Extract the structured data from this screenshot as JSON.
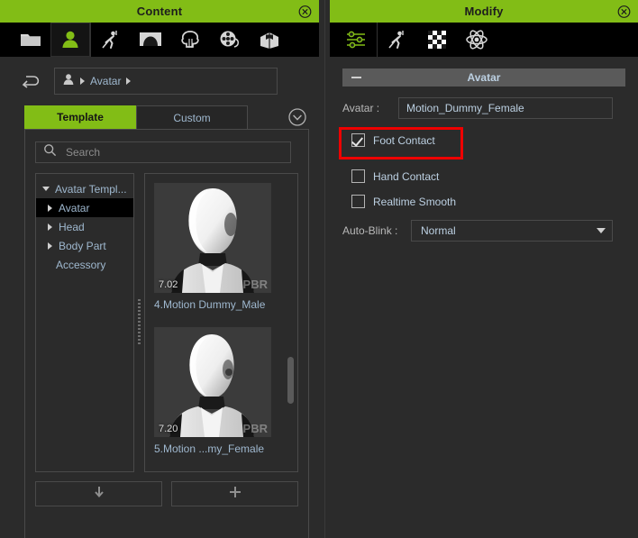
{
  "colors": {
    "accent_green": "#82bd16",
    "panel_bg": "#2b2b2b",
    "tabstrip_bg": "#000000",
    "label_blue": "#9fb8cf",
    "highlight_red": "#ee0000",
    "section_header": "#5a5a5a"
  },
  "content_panel": {
    "title": "Content",
    "close_icon": "close-circle-icon",
    "icon_tabs": [
      {
        "name": "folder-icon",
        "label": "Project",
        "selected": false
      },
      {
        "name": "avatar-person-icon",
        "label": "Avatar",
        "selected": true
      },
      {
        "name": "motion-pose-icon",
        "label": "Motion",
        "selected": false
      },
      {
        "name": "stage-scene-icon",
        "label": "Scene",
        "selected": false
      },
      {
        "name": "tree-prop-icon",
        "label": "Prop",
        "selected": false
      },
      {
        "name": "film-reel-icon",
        "label": "Media",
        "selected": false
      },
      {
        "name": "package-box-icon",
        "label": "Package",
        "selected": false
      }
    ],
    "back_button": "back-arrow-icon",
    "breadcrumb": {
      "icon": "avatar-person-icon",
      "items": [
        "Avatar"
      ]
    },
    "tabs": [
      {
        "label": "Template",
        "active": true
      },
      {
        "label": "Custom",
        "active": false
      }
    ],
    "expand_button": "chevron-down-circle-icon",
    "search": {
      "placeholder": "Search",
      "value": "",
      "icon": "search-icon"
    },
    "tree": [
      {
        "label": "Avatar Templ...",
        "expanded": true,
        "depth": 0,
        "selected": false,
        "has_children": true
      },
      {
        "label": "Avatar",
        "expanded": false,
        "depth": 1,
        "selected": true,
        "has_children": true
      },
      {
        "label": "Head",
        "expanded": false,
        "depth": 1,
        "selected": false,
        "has_children": true
      },
      {
        "label": "Body Part",
        "expanded": false,
        "depth": 1,
        "selected": false,
        "has_children": true
      },
      {
        "label": "Accessory",
        "expanded": false,
        "depth": 2,
        "selected": false,
        "has_children": false
      }
    ],
    "thumbnails": [
      {
        "label": "4.Motion Dummy_Male",
        "version": "7.02",
        "badge": "PBR"
      },
      {
        "label": "5.Motion ...my_Female",
        "version": "7.20",
        "badge": "PBR"
      }
    ],
    "footer_buttons": [
      {
        "name": "download-button",
        "icon": "down-arrow-icon"
      },
      {
        "name": "add-button",
        "icon": "plus-icon"
      }
    ]
  },
  "modify_panel": {
    "title": "Modify",
    "close_icon": "close-circle-icon",
    "icon_tabs": [
      {
        "name": "sliders-attribute-icon",
        "label": "Attribute",
        "selected": true
      },
      {
        "name": "motion-pose-icon",
        "label": "Motion",
        "selected": false
      },
      {
        "name": "checker-material-icon",
        "label": "Material",
        "selected": false
      },
      {
        "name": "atom-physics-icon",
        "label": "Physics",
        "selected": false
      }
    ],
    "section": {
      "title": "Avatar",
      "collapse_icon": "minus-icon",
      "expanded": true
    },
    "avatar_field": {
      "label": "Avatar :",
      "value": "Motion_Dummy_Female"
    },
    "checkboxes": [
      {
        "label": "Foot Contact",
        "checked": true,
        "highlighted": true
      },
      {
        "label": "Hand Contact",
        "checked": false,
        "highlighted": false
      },
      {
        "label": "Realtime Smooth",
        "checked": false,
        "highlighted": false
      }
    ],
    "auto_blink": {
      "label": "Auto-Blink :",
      "value": "Normal",
      "options": [
        "Normal"
      ]
    }
  }
}
